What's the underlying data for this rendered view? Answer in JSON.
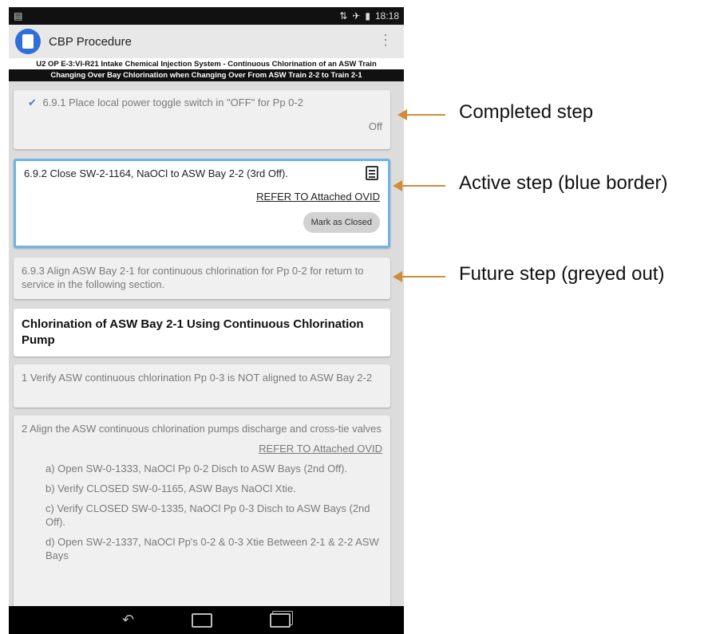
{
  "status": {
    "time": "18:18"
  },
  "app": {
    "title": "CBP Procedure"
  },
  "procedure": {
    "title_line1": "U2 OP E-3:VI-R21 Intake Chemical Injection System - Continuous Chlorination of an ASW Train",
    "title_line2": "Changing Over Bay Chlorination when Changing Over From ASW Train 2-2 to Train 2-1"
  },
  "steps": {
    "s691": {
      "text": "6.9.1 Place local power toggle switch in \"OFF\" for Pp 0-2",
      "value": "Off",
      "state": "completed"
    },
    "s692": {
      "text": "6.9.2 Close SW-2-1164, NaOCl to ASW Bay 2-2 (3rd Off).",
      "link": "REFER TO Attached OVID",
      "action": "Mark as Closed",
      "state": "active"
    },
    "s693": {
      "text": "6.9.3 Align ASW Bay 2-1 for continuous chlorination for Pp 0-2 for return to service in the following section.",
      "state": "future"
    }
  },
  "section": {
    "title": "Chlorination of ASW Bay 2-1 Using Continuous Chlorination Pump"
  },
  "sub_steps": {
    "s1": {
      "text": "1 Verify ASW continuous chlorination Pp 0-3 is NOT aligned to ASW Bay 2-2"
    },
    "s2": {
      "text": "2 Align the ASW continuous chlorination pumps discharge and cross-tie valves",
      "link": "REFER TO Attached OVID",
      "items": [
        "a) Open SW-0-1333, NaOCl Pp 0-2 Disch to ASW Bays (2nd Off).",
        "b) Verify CLOSED SW-0-1165, ASW Bays NaOCl Xtie.",
        "c) Verify CLOSED SW-0-1335, NaOCl Pp 0-3 Disch to ASW Bays (2nd Off).",
        "d) Open SW-2-1337, NaOCl Pp's 0-2 & 0-3 Xtie Between 2-1 & 2-2 ASW Bays"
      ]
    }
  },
  "annotations": {
    "completed": "Completed step",
    "active": "Active step (blue border)",
    "future": "Future step (greyed out)"
  },
  "colors": {
    "active_border": "#6fb3e8",
    "arrow": "#cf8d3b",
    "app_icon": "#2f6fd6"
  },
  "icons": [
    "app-logo-icon",
    "bluetooth-icon",
    "airplane-icon",
    "battery-icon",
    "overflow-menu-icon",
    "checkmark-icon",
    "note-icon",
    "back-icon",
    "home-icon",
    "recent-apps-icon"
  ]
}
